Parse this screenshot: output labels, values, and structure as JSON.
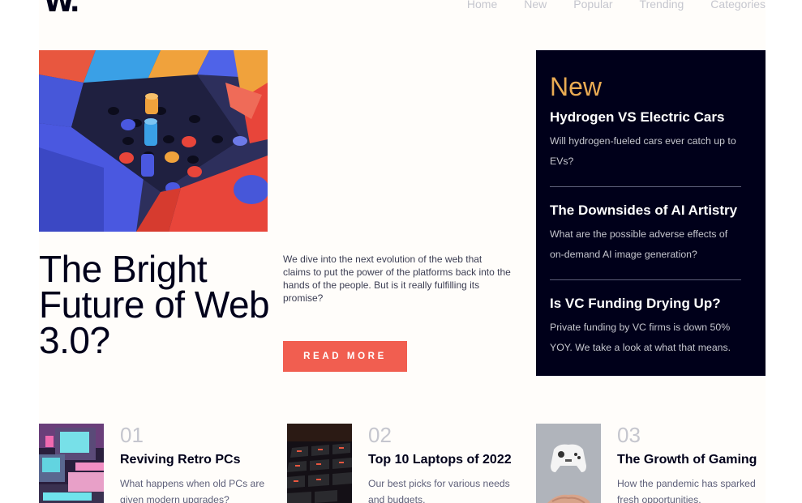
{
  "header": {
    "logo": "W.",
    "nav": [
      "Home",
      "New",
      "Popular",
      "Trending",
      "Categories"
    ]
  },
  "hero": {
    "title": "The Bright Future of Web 3.0?",
    "description": "We dive into the next evolution of the web that claims to put the power of the platforms back into the hands of the people. But is it really fulfilling its promise?",
    "button": "READ MORE"
  },
  "new_panel": {
    "heading": "New",
    "items": [
      {
        "title": "Hydrogen VS Electric Cars",
        "text": "Will hydrogen-fueled cars ever catch up to EVs?"
      },
      {
        "title": "The Downsides of AI Artistry",
        "text": "What are the possible adverse effects of on-demand AI image generation?"
      },
      {
        "title": "Is VC Funding Drying Up?",
        "text": "Private funding by VC firms is down 50% YOY. We take a look at what that means."
      }
    ]
  },
  "articles": [
    {
      "number": "01",
      "title": "Reviving Retro PCs",
      "text": "What happens when old PCs are given modern upgrades?"
    },
    {
      "number": "02",
      "title": "Top 10 Laptops of 2022",
      "text": "Our best picks for various needs and budgets."
    },
    {
      "number": "03",
      "title": "The Growth of Gaming",
      "text": "How the pandemic has sparked fresh opportunities."
    }
  ],
  "colors": {
    "accent_orange": "#e9ab53",
    "button_red": "#f15e50",
    "dark_navy": "#00001a",
    "off_white": "#fffdfa"
  }
}
